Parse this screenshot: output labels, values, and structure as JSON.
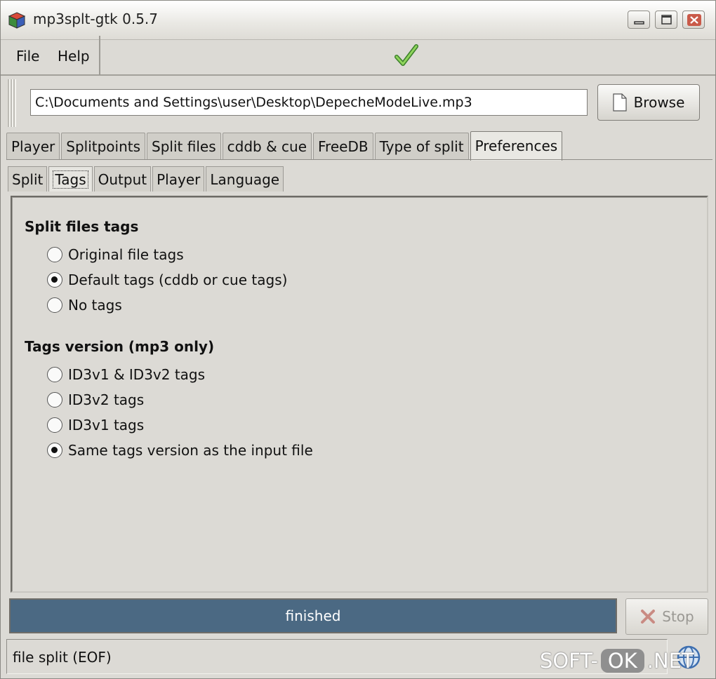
{
  "window": {
    "title": "mp3splt-gtk 0.5.7"
  },
  "menu": {
    "file": "File",
    "help": "Help"
  },
  "file_row": {
    "path": "C:\\Documents and Settings\\user\\Desktop\\DepecheModeLive.mp3",
    "browse_label": "Browse"
  },
  "tabs": [
    {
      "label": "Player",
      "active": false
    },
    {
      "label": "Splitpoints",
      "active": false
    },
    {
      "label": "Split files",
      "active": false
    },
    {
      "label": "cddb & cue",
      "active": false
    },
    {
      "label": "FreeDB",
      "active": false
    },
    {
      "label": "Type of split",
      "active": false
    },
    {
      "label": "Preferences",
      "active": true
    }
  ],
  "subtabs": [
    {
      "label": "Split",
      "active": false
    },
    {
      "label": "Tags",
      "active": true
    },
    {
      "label": "Output",
      "active": false
    },
    {
      "label": "Player",
      "active": false
    },
    {
      "label": "Language",
      "active": false
    }
  ],
  "split_tags": {
    "title": "Split files tags",
    "options": [
      {
        "label": "Original file tags",
        "checked": false
      },
      {
        "label": "Default tags (cddb or cue tags)",
        "checked": true
      },
      {
        "label": "No tags",
        "checked": false
      }
    ]
  },
  "tags_version": {
    "title": "Tags version (mp3 only)",
    "options": [
      {
        "label": "ID3v1 & ID3v2 tags",
        "checked": false
      },
      {
        "label": "ID3v2 tags",
        "checked": false
      },
      {
        "label": "ID3v1 tags",
        "checked": false
      },
      {
        "label": "Same tags version as the input file",
        "checked": true
      }
    ]
  },
  "progress": {
    "text": "finished",
    "fraction": 1.0,
    "color": "#4b6983"
  },
  "stop_label": "Stop",
  "status": {
    "text": "file split (EOF)"
  },
  "watermark": {
    "left": "SOFT-",
    "middle": "OK",
    "right": ".NET"
  }
}
